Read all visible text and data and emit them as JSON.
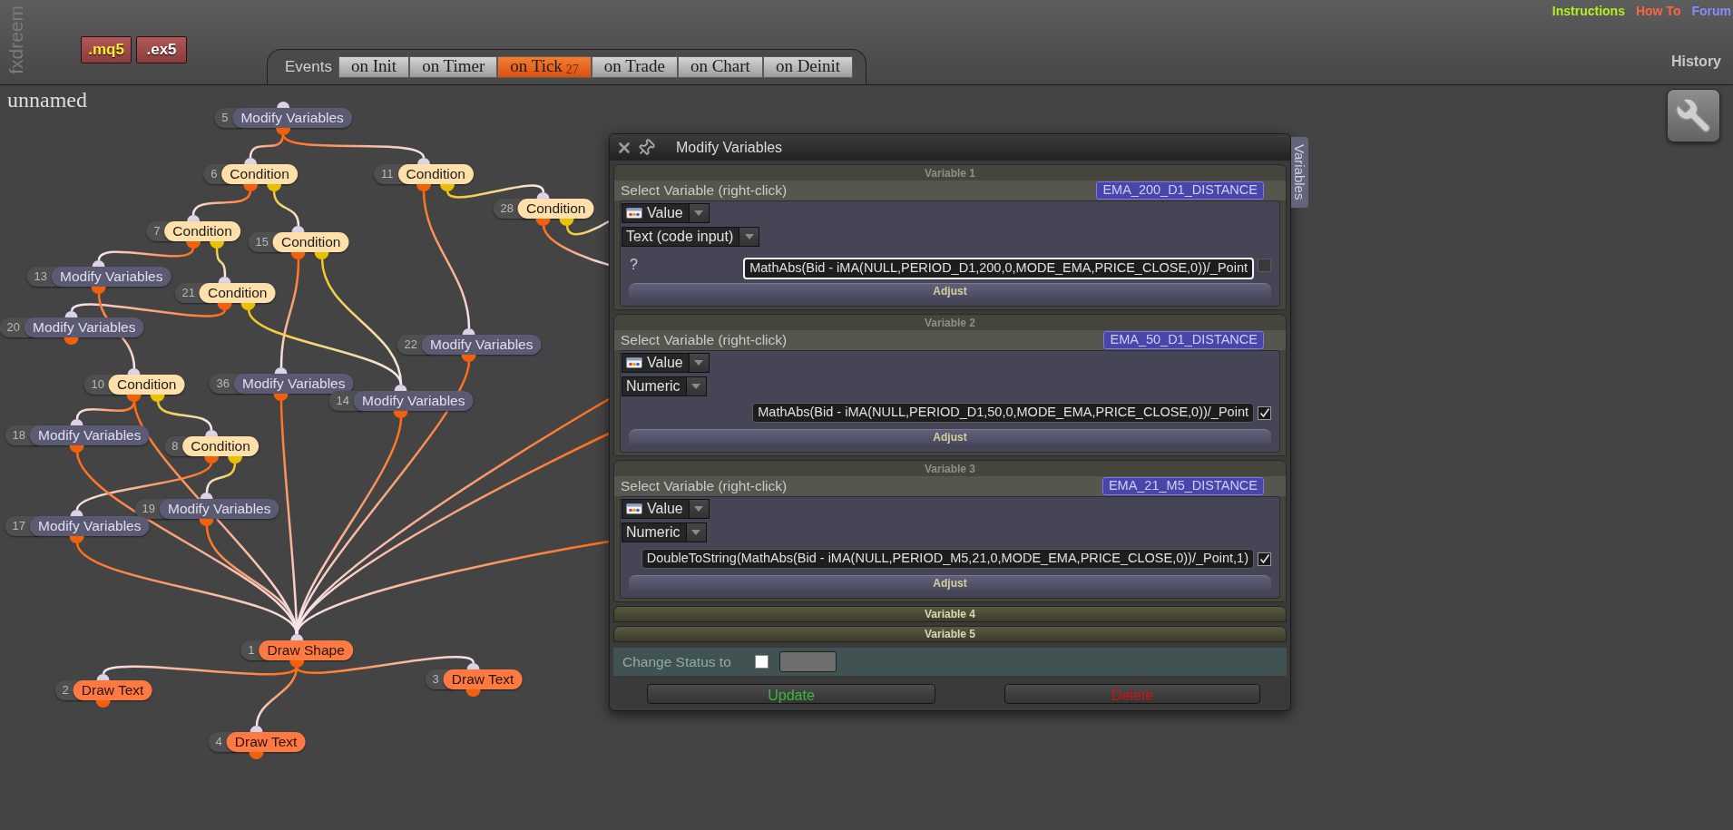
{
  "brand": {
    "text": "fxdreem"
  },
  "file_buttons": [
    {
      "label": ".mq5",
      "kind": "source"
    },
    {
      "label": ".ex5",
      "kind": "compiled"
    }
  ],
  "events": {
    "label": "Events",
    "tabs": [
      {
        "label": "on Init",
        "selected": false
      },
      {
        "label": "on Timer",
        "selected": false
      },
      {
        "label": "on Tick",
        "count": "27",
        "selected": true
      },
      {
        "label": "on Trade",
        "selected": false
      },
      {
        "label": "on Chart",
        "selected": false
      },
      {
        "label": "on Deinit",
        "selected": false
      }
    ]
  },
  "links": [
    {
      "label": "Instructions",
      "color": "#b2f020"
    },
    {
      "label": "How To",
      "color": "#ff6440"
    },
    {
      "label": "Forum",
      "color": "#8a8aff"
    }
  ],
  "history": {
    "label": "History"
  },
  "project": {
    "name": "unnamed"
  },
  "canvas": {
    "nodes": [
      {
        "number": "5",
        "label": "Modify Variables",
        "kind": "modify"
      },
      {
        "number": "6",
        "label": "Condition",
        "kind": "condition"
      },
      {
        "number": "11",
        "label": "Condition",
        "kind": "condition"
      },
      {
        "number": "28",
        "label": "Condition",
        "kind": "condition"
      },
      {
        "number": "7",
        "label": "Condition",
        "kind": "condition"
      },
      {
        "number": "15",
        "label": "Condition",
        "kind": "condition"
      },
      {
        "number": "13",
        "label": "Modify Variables",
        "kind": "modify"
      },
      {
        "number": "21",
        "label": "Condition",
        "kind": "condition"
      },
      {
        "number": "20",
        "label": "Modify Variables",
        "kind": "modify"
      },
      {
        "number": "22",
        "label": "Modify Variables",
        "kind": "modify"
      },
      {
        "number": "10",
        "label": "Condition",
        "kind": "condition"
      },
      {
        "number": "36",
        "label": "Modify Variables",
        "kind": "modify"
      },
      {
        "number": "14",
        "label": "Modify Variables",
        "kind": "modify"
      },
      {
        "number": "18",
        "label": "Modify Variables",
        "kind": "modify"
      },
      {
        "number": "8",
        "label": "Condition",
        "kind": "condition"
      },
      {
        "number": "19",
        "label": "Modify Variables",
        "kind": "modify"
      },
      {
        "number": "17",
        "label": "Modify Variables",
        "kind": "modify"
      },
      {
        "number": "1",
        "label": "Draw Shape",
        "kind": "draw"
      },
      {
        "number": "2",
        "label": "Draw Text",
        "kind": "draw"
      },
      {
        "number": "3",
        "label": "Draw Text",
        "kind": "draw"
      },
      {
        "number": "4",
        "label": "Draw Text",
        "kind": "draw"
      }
    ]
  },
  "dialog": {
    "title": "Modify Variables",
    "side_tab": "Variables",
    "variables": [
      {
        "header": "Variable 1",
        "expanded": true,
        "select_label": "Select Variable (right-click)",
        "variable": "EMA_200_D1_DISTANCE",
        "source": "Value",
        "type": "Text (code input)",
        "field_label": "?",
        "value": "MathAbs(Bid - iMA(NULL,PERIOD_D1,200,0,MODE_EMA,PRICE_CLOSE,0))/_Point",
        "focused": true,
        "checked": false,
        "adjust": "Adjust"
      },
      {
        "header": "Variable 2",
        "expanded": true,
        "select_label": "Select Variable (right-click)",
        "variable": "EMA_50_D1_DISTANCE",
        "source": "Value",
        "type": "Numeric",
        "value": "MathAbs(Bid - iMA(NULL,PERIOD_D1,50,0,MODE_EMA,PRICE_CLOSE,0))/_Point",
        "focused": false,
        "checked": true,
        "adjust": "Adjust"
      },
      {
        "header": "Variable 3",
        "expanded": true,
        "select_label": "Select Variable (right-click)",
        "variable": "EMA_21_M5_DISTANCE",
        "source": "Value",
        "type": "Numeric",
        "value": "DoubleToString(MathAbs(Bid - iMA(NULL,PERIOD_M5,21,0,MODE_EMA,PRICE_CLOSE,0))/_Point,1)",
        "focused": false,
        "checked": true,
        "adjust": "Adjust"
      },
      {
        "header": "Variable 4",
        "expanded": false
      },
      {
        "header": "Variable 5",
        "expanded": false
      }
    ],
    "status": {
      "label": "Change Status to",
      "checked": false
    },
    "buttons": [
      {
        "label": "Update",
        "kind": "update"
      },
      {
        "label": "Delete",
        "kind": "delete"
      }
    ]
  }
}
